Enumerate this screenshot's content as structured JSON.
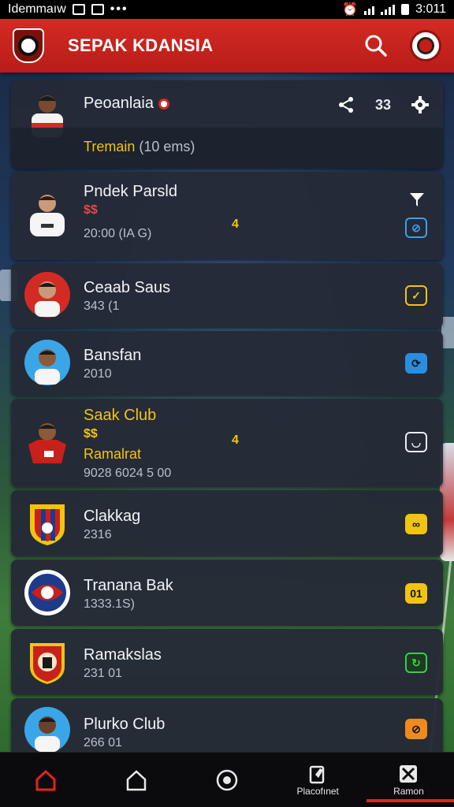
{
  "status_bar": {
    "carrier_text": "Idemmaıw",
    "time": "3:011",
    "icons": [
      "photo-icon",
      "image-icon",
      "more-dots-icon",
      "alarm-icon",
      "wifi-icon",
      "signal-icon",
      "battery-icon"
    ]
  },
  "header": {
    "title": "SEPAK KDANSIA",
    "logo": "club-crest-icon",
    "actions": [
      "search-icon",
      "profile-badge-icon"
    ],
    "accent_color": "#d42a24"
  },
  "featured": {
    "name": "Peoanlaia",
    "action_count": "33",
    "remain_label": "Tremain",
    "remain_detail": "(10 ems)",
    "actions": [
      "share-icon",
      "count-label",
      "settings-icon"
    ]
  },
  "list": [
    {
      "name": "Pndek Parsld",
      "line2": "$$",
      "line3": "20:00 (IA G)",
      "mid": "4",
      "status_icon": "filter-icon",
      "status_color": "#3aa0e8",
      "avatar": "player-jersey-white"
    },
    {
      "name": "Ceaab Saus",
      "line2": "343 (1",
      "status_icon": "check-icon",
      "status_color": "#f2c40f",
      "avatar": "player-red-circle"
    },
    {
      "name": "Bansfan",
      "line2": "2010",
      "status_icon": "refresh-icon",
      "status_color": "#3aa0e8",
      "avatar": "player-blue-circle"
    },
    {
      "name": "Saak Club",
      "line2": "$$",
      "line3": "Ramalrat",
      "line4": "9028 6024 5 00",
      "mid": "4",
      "status_icon": "clock-icon",
      "status_color": "#e8ecf2",
      "avatar": "player-jersey-red"
    },
    {
      "name": "Clakkag",
      "line2": "2316",
      "status_icon": "binoculars-icon",
      "status_color": "#f2c40f",
      "avatar": "club-badge-striped"
    },
    {
      "name": "Tranana Bak",
      "line2": "1333.1S)",
      "status_icon": "score-icon",
      "status_color": "#f2c40f",
      "avatar": "club-badge-round"
    },
    {
      "name": "Ramakslas",
      "line2": "231 01",
      "status_icon": "sync-icon",
      "status_color": "#3ecb4a",
      "avatar": "club-badge-shield"
    },
    {
      "name": "Plurko Club",
      "line2": "266 01",
      "status_icon": "link-icon",
      "status_color": "#f08a1c",
      "avatar": "player-blue-circle-2"
    }
  ],
  "bottom_nav": [
    {
      "icon": "home-icon",
      "label": "",
      "active": true
    },
    {
      "icon": "house-outline-icon",
      "label": ""
    },
    {
      "icon": "record-icon",
      "label": ""
    },
    {
      "icon": "clipboard-icon",
      "label": "Placofınet"
    },
    {
      "icon": "tactics-icon",
      "label": "Ramon"
    }
  ]
}
